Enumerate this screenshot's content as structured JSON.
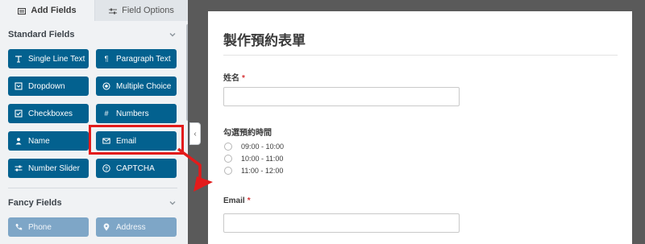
{
  "builder": {
    "tabs": {
      "add_fields": "Add Fields",
      "field_options": "Field Options"
    },
    "sections": {
      "standard": "Standard Fields",
      "fancy": "Fancy Fields"
    },
    "standard_fields": [
      {
        "label": "Single Line Text",
        "icon": "text-cursor-icon"
      },
      {
        "label": "Paragraph Text",
        "icon": "paragraph-icon"
      },
      {
        "label": "Dropdown",
        "icon": "dropdown-icon"
      },
      {
        "label": "Multiple Choice",
        "icon": "radio-icon"
      },
      {
        "label": "Checkboxes",
        "icon": "checkbox-icon"
      },
      {
        "label": "Numbers",
        "icon": "hash-icon"
      },
      {
        "label": "Name",
        "icon": "user-icon"
      },
      {
        "label": "Email",
        "icon": "envelope-icon"
      },
      {
        "label": "Number Slider",
        "icon": "slider-icon"
      },
      {
        "label": "CAPTCHA",
        "icon": "question-icon"
      }
    ],
    "fancy_fields": [
      {
        "label": "Phone",
        "icon": "phone-icon"
      },
      {
        "label": "Address",
        "icon": "map-pin-icon"
      }
    ]
  },
  "form": {
    "title": "製作預約表單",
    "name_label": "姓名",
    "time_label": "勾選預約時間",
    "time_options": [
      "09:00 - 10:00",
      "10:00 - 11:00",
      "11:00 - 12:00"
    ],
    "email_label": "Email",
    "required_mark": "*"
  },
  "colors": {
    "button_blue": "#03618f",
    "highlight_red": "#e31b1b",
    "required_red": "#d63638"
  }
}
